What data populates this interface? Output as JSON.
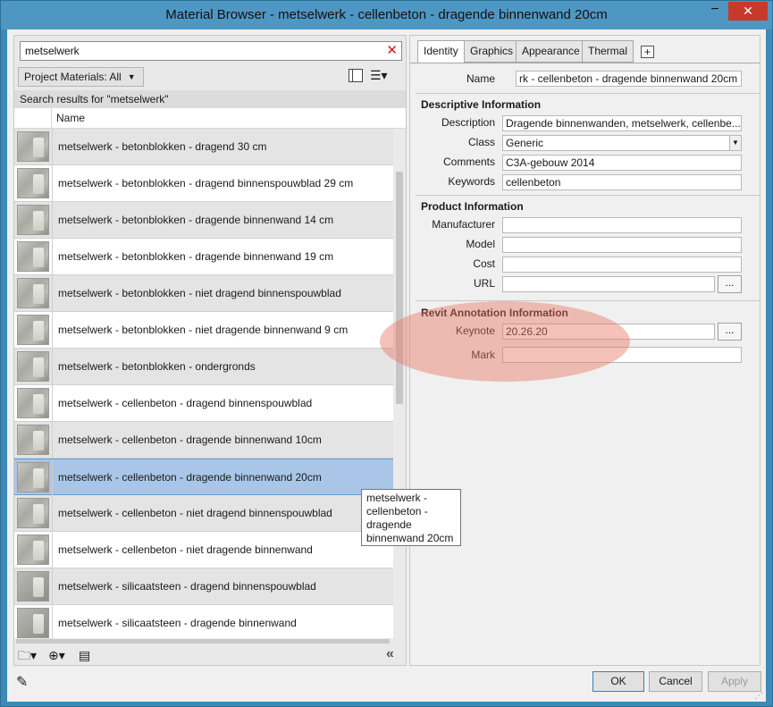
{
  "window": {
    "title": "Material Browser - metselwerk - cellenbeton - dragende binnenwand 20cm",
    "minimize_glyph": "−",
    "close_glyph": "✕"
  },
  "left": {
    "search_value": "metselwerk",
    "search_clear_glyph": "✕",
    "project_materials_label": "Project Materials: All",
    "results_header": "Search results for \"metselwerk\"",
    "column_name": "Name",
    "materials": [
      "metselwerk - betonblokken - dragend 30 cm",
      "metselwerk - betonblokken - dragend binnenspouwblad 29 cm",
      "metselwerk - betonblokken - dragende binnenwand 14 cm",
      "metselwerk - betonblokken - dragende binnenwand 19 cm",
      "metselwerk - betonblokken - niet dragend binnenspouwblad",
      "metselwerk - betonblokken - niet dragende binnenwand 9 cm",
      "metselwerk - betonblokken - ondergronds",
      "metselwerk - cellenbeton - dragend binnenspouwblad",
      "metselwerk - cellenbeton - dragende binnenwand 10cm",
      "metselwerk - cellenbeton - dragende binnenwand 20cm",
      "metselwerk - cellenbeton - niet dragend binnenspouwblad",
      "metselwerk - cellenbeton - niet dragende binnenwand",
      "metselwerk - silicaatsteen - dragend binnenspouwblad",
      "metselwerk - silicaatsteen - dragende binnenwand"
    ],
    "selected_index": 9,
    "collapse_glyph": "«"
  },
  "tooltip": {
    "line1": "metselwerk -",
    "line2": "cellenbeton -",
    "line3": "dragende",
    "line4": "binnenwand 20cm"
  },
  "right": {
    "tabs": [
      "Identity",
      "Graphics",
      "Appearance",
      "Thermal"
    ],
    "active_tab": "Identity",
    "tab_add_glyph": "+",
    "name_label": "Name",
    "name_value": "rk - cellenbeton - dragende binnenwand 20cm",
    "descriptive": {
      "title": "Descriptive Information",
      "description_label": "Description",
      "description_value": "Dragende binnenwanden, metselwerk, cellenbe...",
      "class_label": "Class",
      "class_value": "Generic",
      "comments_label": "Comments",
      "comments_value": "C3A-gebouw 2014",
      "keywords_label": "Keywords",
      "keywords_value": "cellenbeton"
    },
    "product": {
      "title": "Product Information",
      "manufacturer_label": "Manufacturer",
      "manufacturer_value": "",
      "model_label": "Model",
      "model_value": "",
      "cost_label": "Cost",
      "cost_value": "",
      "url_label": "URL",
      "url_value": "",
      "url_button": "..."
    },
    "annotation": {
      "title": "Revit Annotation Information",
      "keynote_label": "Keynote",
      "keynote_value": "20.26.20",
      "keynote_button": "...",
      "mark_label": "Mark",
      "mark_value": ""
    }
  },
  "buttons": {
    "ok": "OK",
    "cancel": "Cancel",
    "apply": "Apply"
  },
  "colors": {
    "titlebar": "#4f97c3",
    "selection": "#a9c6e8",
    "highlight": "#e77864"
  }
}
